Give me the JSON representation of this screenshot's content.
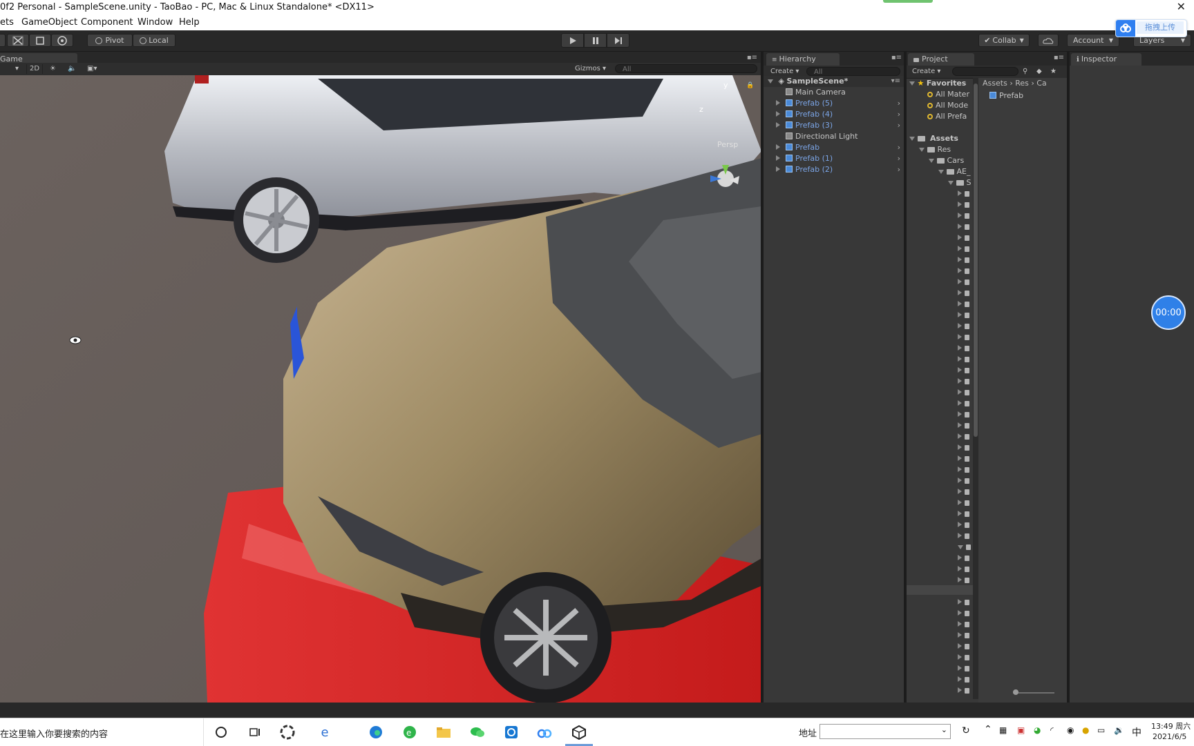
{
  "window": {
    "title": "0f2 Personal - SampleScene.unity - TaoBao - PC, Mac & Linux Standalone* <DX11>",
    "close_glyph": "✕"
  },
  "menu": [
    "ets",
    "GameObject",
    "Component",
    "Window",
    "Help"
  ],
  "toolbar": {
    "pivot_label": "Pivot",
    "local_label": "Local",
    "collab_label": "Collab",
    "account_label": "Account",
    "layers_label": "Layers",
    "upload_label": "拖拽上传"
  },
  "game": {
    "tab_label": "Game",
    "mode_2d": "2D",
    "gizmos_label": "Gizmos",
    "search_placeholder": "All",
    "persp_label": "Persp",
    "axis_y": "y",
    "axis_z": "z"
  },
  "hierarchy": {
    "tab_label": "Hierarchy",
    "create_label": "Create",
    "search_placeholder": "All",
    "scene_name": "SampleScene*",
    "items": [
      {
        "label": "Main Camera",
        "prefab": false,
        "expandable": false
      },
      {
        "label": "Prefab (5)",
        "prefab": true,
        "expandable": true
      },
      {
        "label": "Prefab (4)",
        "prefab": true,
        "expandable": true
      },
      {
        "label": "Prefab (3)",
        "prefab": true,
        "expandable": true
      },
      {
        "label": "Directional Light",
        "prefab": false,
        "expandable": false
      },
      {
        "label": "Prefab",
        "prefab": true,
        "expandable": true
      },
      {
        "label": "Prefab (1)",
        "prefab": true,
        "expandable": true
      },
      {
        "label": "Prefab (2)",
        "prefab": true,
        "expandable": true
      }
    ]
  },
  "project": {
    "tab_label": "Project",
    "create_label": "Create",
    "favorites_label": "Favorites",
    "favorites": [
      "All Mater",
      "All Mode",
      "All Prefa"
    ],
    "assets_label": "Assets",
    "tree": [
      "Res",
      "Cars",
      "AE_",
      "S"
    ],
    "breadcrumb": [
      "Assets",
      "Res",
      "Ca"
    ],
    "grid_items": [
      "Prefab"
    ]
  },
  "inspector": {
    "tab_label": "Inspector"
  },
  "overlay": {
    "timer": "00:00"
  },
  "taskbar": {
    "search_placeholder": "在这里输入你要搜索的内容",
    "address_label": "地址",
    "ime_label": "中",
    "time": "13:49 周六",
    "date": "2021/6/5"
  }
}
